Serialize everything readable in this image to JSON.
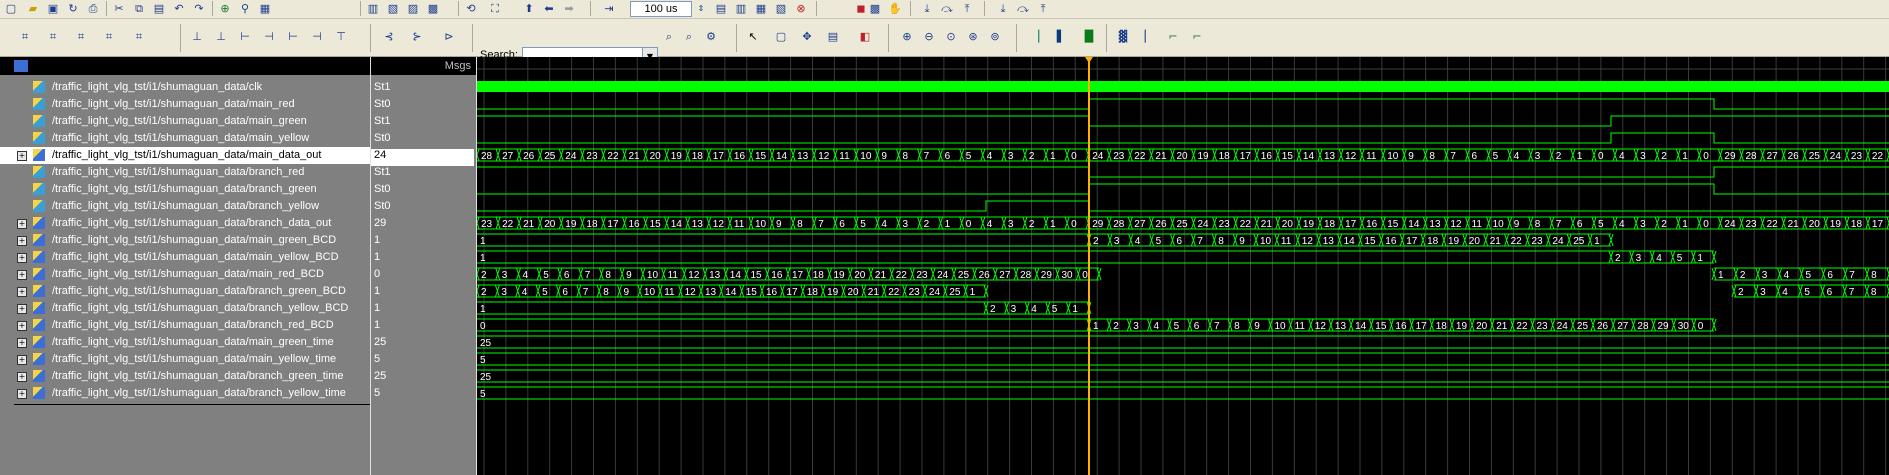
{
  "toolbar": {
    "zoom_value": "100 us",
    "search_label": "Search:",
    "search_value": ""
  },
  "icons": [
    "new-icon",
    "open-icon",
    "save-icon",
    "print-icon",
    "cut-icon",
    "copy-icon",
    "paste-icon",
    "undo-icon",
    "find-icon",
    "run-icon",
    "step-icon",
    "zoom-in-icon",
    "zoom-out-icon",
    "zoom-full-icon",
    "cursor-icon",
    "search-icon"
  ],
  "colors": {
    "wave": "#00ff00",
    "cursor": "#ffb000",
    "pane": "#808080",
    "background": "#000000"
  },
  "signals_header": {
    "values_label": "Msgs"
  },
  "signals": [
    {
      "name": "/traffic_light_vlg_tst/i1/shumaguan_data/clk",
      "value": "St1",
      "bus": false,
      "selected": false
    },
    {
      "name": "/traffic_light_vlg_tst/i1/shumaguan_data/main_red",
      "value": "St0",
      "bus": false,
      "selected": false
    },
    {
      "name": "/traffic_light_vlg_tst/i1/shumaguan_data/main_green",
      "value": "St1",
      "bus": false,
      "selected": false
    },
    {
      "name": "/traffic_light_vlg_tst/i1/shumaguan_data/main_yellow",
      "value": "St0",
      "bus": false,
      "selected": false
    },
    {
      "name": "/traffic_light_vlg_tst/i1/shumaguan_data/main_data_out",
      "value": "24",
      "bus": true,
      "selected": true
    },
    {
      "name": "/traffic_light_vlg_tst/i1/shumaguan_data/branch_red",
      "value": "St1",
      "bus": false,
      "selected": false
    },
    {
      "name": "/traffic_light_vlg_tst/i1/shumaguan_data/branch_green",
      "value": "St0",
      "bus": false,
      "selected": false
    },
    {
      "name": "/traffic_light_vlg_tst/i1/shumaguan_data/branch_yellow",
      "value": "St0",
      "bus": false,
      "selected": false
    },
    {
      "name": "/traffic_light_vlg_tst/i1/shumaguan_data/branch_data_out",
      "value": "29",
      "bus": true,
      "selected": false
    },
    {
      "name": "/traffic_light_vlg_tst/i1/shumaguan_data/main_green_BCD",
      "value": "1",
      "bus": true,
      "selected": false
    },
    {
      "name": "/traffic_light_vlg_tst/i1/shumaguan_data/main_yellow_BCD",
      "value": "1",
      "bus": true,
      "selected": false
    },
    {
      "name": "/traffic_light_vlg_tst/i1/shumaguan_data/main_red_BCD",
      "value": "0",
      "bus": true,
      "selected": false
    },
    {
      "name": "/traffic_light_vlg_tst/i1/shumaguan_data/branch_green_BCD",
      "value": "1",
      "bus": true,
      "selected": false
    },
    {
      "name": "/traffic_light_vlg_tst/i1/shumaguan_data/branch_yellow_BCD",
      "value": "1",
      "bus": true,
      "selected": false
    },
    {
      "name": "/traffic_light_vlg_tst/i1/shumaguan_data/branch_red_BCD",
      "value": "1",
      "bus": true,
      "selected": false
    },
    {
      "name": "/traffic_light_vlg_tst/i1/shumaguan_data/main_green_time",
      "value": "25",
      "bus": true,
      "selected": false
    },
    {
      "name": "/traffic_light_vlg_tst/i1/shumaguan_data/main_yellow_time",
      "value": "5",
      "bus": true,
      "selected": false
    },
    {
      "name": "/traffic_light_vlg_tst/i1/shumaguan_data/branch_green_time",
      "value": "25",
      "bus": true,
      "selected": false
    },
    {
      "name": "/traffic_light_vlg_tst/i1/shumaguan_data/branch_yellow_time",
      "value": "5",
      "bus": true,
      "selected": false
    }
  ],
  "waves": {
    "main_data_out": [
      "28",
      "27",
      "26",
      "25",
      "24",
      "23",
      "22",
      "21",
      "20",
      "19",
      "18",
      "17",
      "16",
      "15",
      "14",
      "13",
      "12",
      "11",
      "10",
      "9",
      "8",
      "7",
      "6",
      "5",
      "4",
      "3",
      "2",
      "1",
      "0",
      "24",
      "23",
      "22",
      "21",
      "20",
      "19",
      "18",
      "17",
      "16",
      "15",
      "14",
      "13",
      "12",
      "11",
      "10",
      "9",
      "8",
      "7",
      "6",
      "5",
      "4",
      "3",
      "2",
      "1",
      "0",
      "4",
      "3",
      "2",
      "1",
      "0",
      "29",
      "28",
      "27",
      "26",
      "25",
      "24",
      "23",
      "22"
    ],
    "branch_data_out": [
      "23",
      "22",
      "21",
      "20",
      "19",
      "18",
      "17",
      "16",
      "15",
      "14",
      "13",
      "12",
      "11",
      "10",
      "9",
      "8",
      "7",
      "6",
      "5",
      "4",
      "3",
      "2",
      "1",
      "0",
      "4",
      "3",
      "2",
      "1",
      "0",
      "29",
      "28",
      "27",
      "26",
      "25",
      "24",
      "23",
      "22",
      "21",
      "20",
      "19",
      "18",
      "17",
      "16",
      "15",
      "14",
      "13",
      "12",
      "11",
      "10",
      "9",
      "8",
      "7",
      "6",
      "5",
      "4",
      "3",
      "2",
      "1",
      "0",
      "24",
      "23",
      "22",
      "21",
      "20",
      "19",
      "18",
      "17"
    ],
    "main_green_BCD_a": "1",
    "main_green_BCD_b": [
      "2",
      "3",
      "4",
      "5",
      "6",
      "7",
      "8",
      "9",
      "10",
      "11",
      "12",
      "13",
      "14",
      "15",
      "16",
      "17",
      "18",
      "19",
      "20",
      "21",
      "22",
      "23",
      "24",
      "25",
      "1"
    ],
    "main_yellow_BCD_a": "1",
    "main_yellow_BCD_b": [
      "2",
      "3",
      "4",
      "5",
      "1"
    ],
    "main_red_BCD_a": [
      "2",
      "3",
      "4",
      "5",
      "6",
      "7",
      "8",
      "9",
      "10",
      "11",
      "12",
      "13",
      "14",
      "15",
      "16",
      "17",
      "18",
      "19",
      "20",
      "21",
      "22",
      "23",
      "24",
      "25",
      "26",
      "27",
      "28",
      "29",
      "30",
      "0"
    ],
    "main_red_BCD_b": [
      "1",
      "2",
      "3",
      "4",
      "5",
      "6",
      "7",
      "8"
    ],
    "branch_green_BCD_a": [
      "2",
      "3",
      "4",
      "5",
      "6",
      "7",
      "8",
      "9",
      "10",
      "11",
      "12",
      "13",
      "14",
      "15",
      "16",
      "17",
      "18",
      "19",
      "20",
      "21",
      "22",
      "23",
      "24",
      "25",
      "1"
    ],
    "branch_green_BCD_b": [
      "2",
      "3",
      "4",
      "5",
      "6",
      "7",
      "8"
    ],
    "branch_yellow_BCD_a": "1",
    "branch_yellow_BCD_b": [
      "2",
      "3",
      "4",
      "5",
      "1"
    ],
    "branch_red_BCD_a": "0",
    "branch_red_BCD_b": [
      "1",
      "2",
      "3",
      "4",
      "5",
      "6",
      "7",
      "8",
      "9",
      "10",
      "11",
      "12",
      "13",
      "14",
      "15",
      "16",
      "17",
      "18",
      "19",
      "20",
      "21",
      "22",
      "23",
      "24",
      "25",
      "26",
      "27",
      "28",
      "29",
      "30",
      "0"
    ],
    "main_green_time": "25",
    "main_yellow_time": "5",
    "branch_green_time": "25",
    "branch_yellow_time": "5"
  }
}
